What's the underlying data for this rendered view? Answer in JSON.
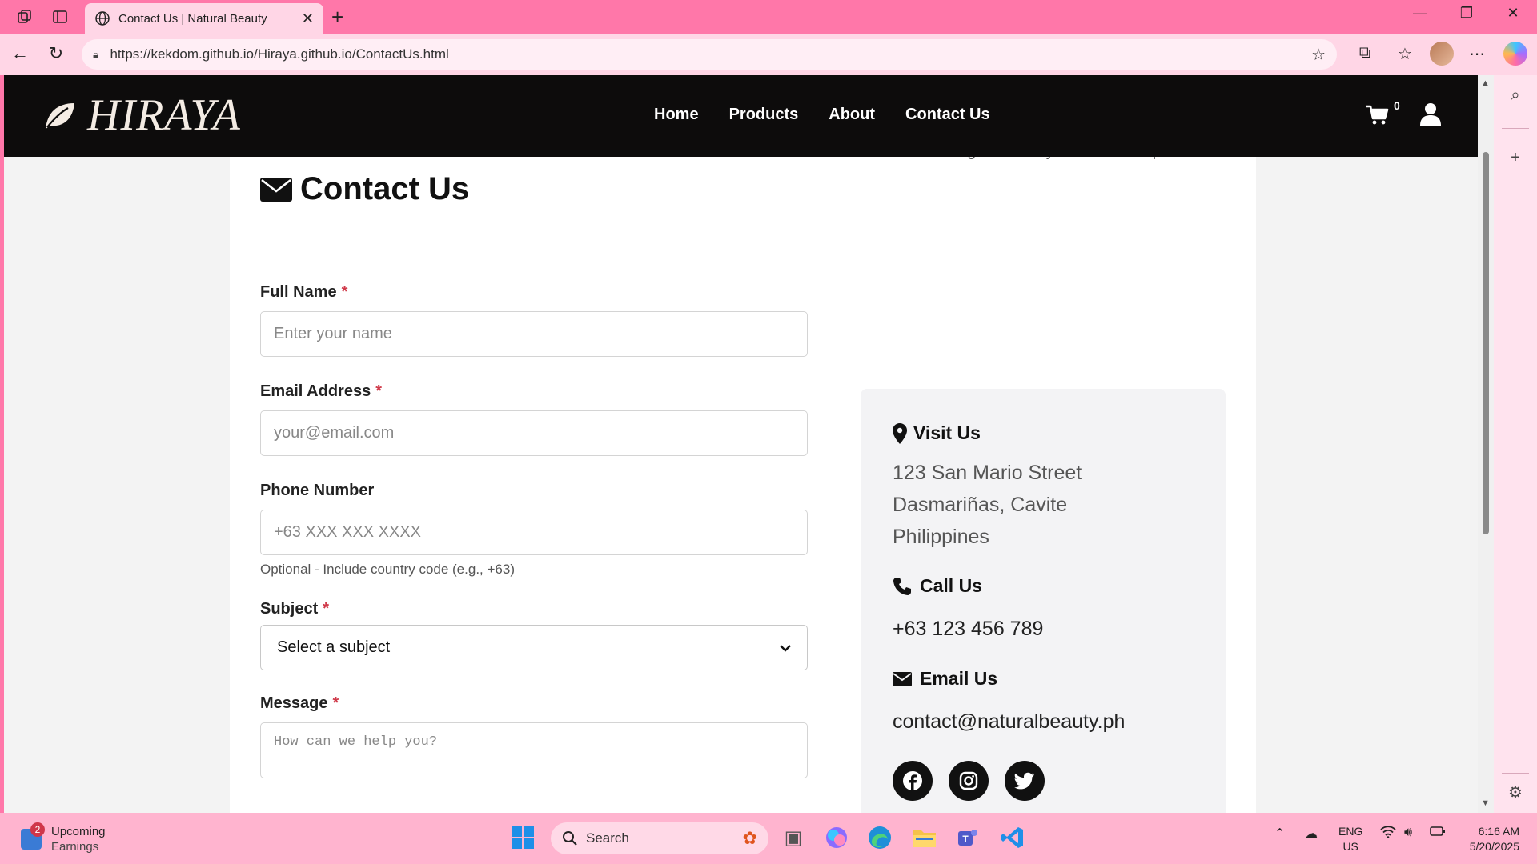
{
  "browser": {
    "tab_title": "Contact Us | Natural Beauty",
    "url": "https://kekdom.github.io/Hiraya.github.io/ContactUs.html",
    "new_tab": "+"
  },
  "site": {
    "logo_text": "HIRAYA",
    "nav": [
      "Home",
      "Products",
      "About",
      "Contact Us"
    ],
    "cart_count": "0"
  },
  "contact": {
    "title": "Contact Us",
    "intro": "We'd love to hear from you! Please fill out the form below and we'll get back to you as soon as possible.",
    "form": {
      "full_name_label": "Full Name",
      "full_name_placeholder": "Enter your name",
      "email_label": "Email Address",
      "email_placeholder": "your@email.com",
      "phone_label": "Phone Number",
      "phone_placeholder": "+63 XXX XXX XXXX",
      "phone_hint": "Optional - Include country code (e.g., +63)",
      "subject_label": "Subject",
      "subject_value": "Select a subject",
      "message_label": "Message",
      "message_placeholder": "How can we help you?",
      "required_mark": "*"
    },
    "info": {
      "visit_title": "Visit Us",
      "address_line1": "123 San Mario Street",
      "address_line2": "Dasmariñas, Cavite",
      "address_line3": "Philippines",
      "call_title": "Call Us",
      "phone": "+63 123 456 789",
      "email_title": "Email Us",
      "email": "contact@naturalbeauty.ph",
      "social": [
        "facebook-icon",
        "instagram-icon",
        "twitter-icon"
      ]
    }
  },
  "taskbar": {
    "widget_badge": "2",
    "widget_title": "Upcoming",
    "widget_sub": "Earnings",
    "search_label": "Search",
    "lang_1": "ENG",
    "lang_2": "US",
    "time": "6:16 AM",
    "date": "5/20/2025"
  },
  "colors": {
    "browser_frame": "#ff77a9",
    "site_nav": "#0d0c0c",
    "required": "#d03a4a"
  }
}
